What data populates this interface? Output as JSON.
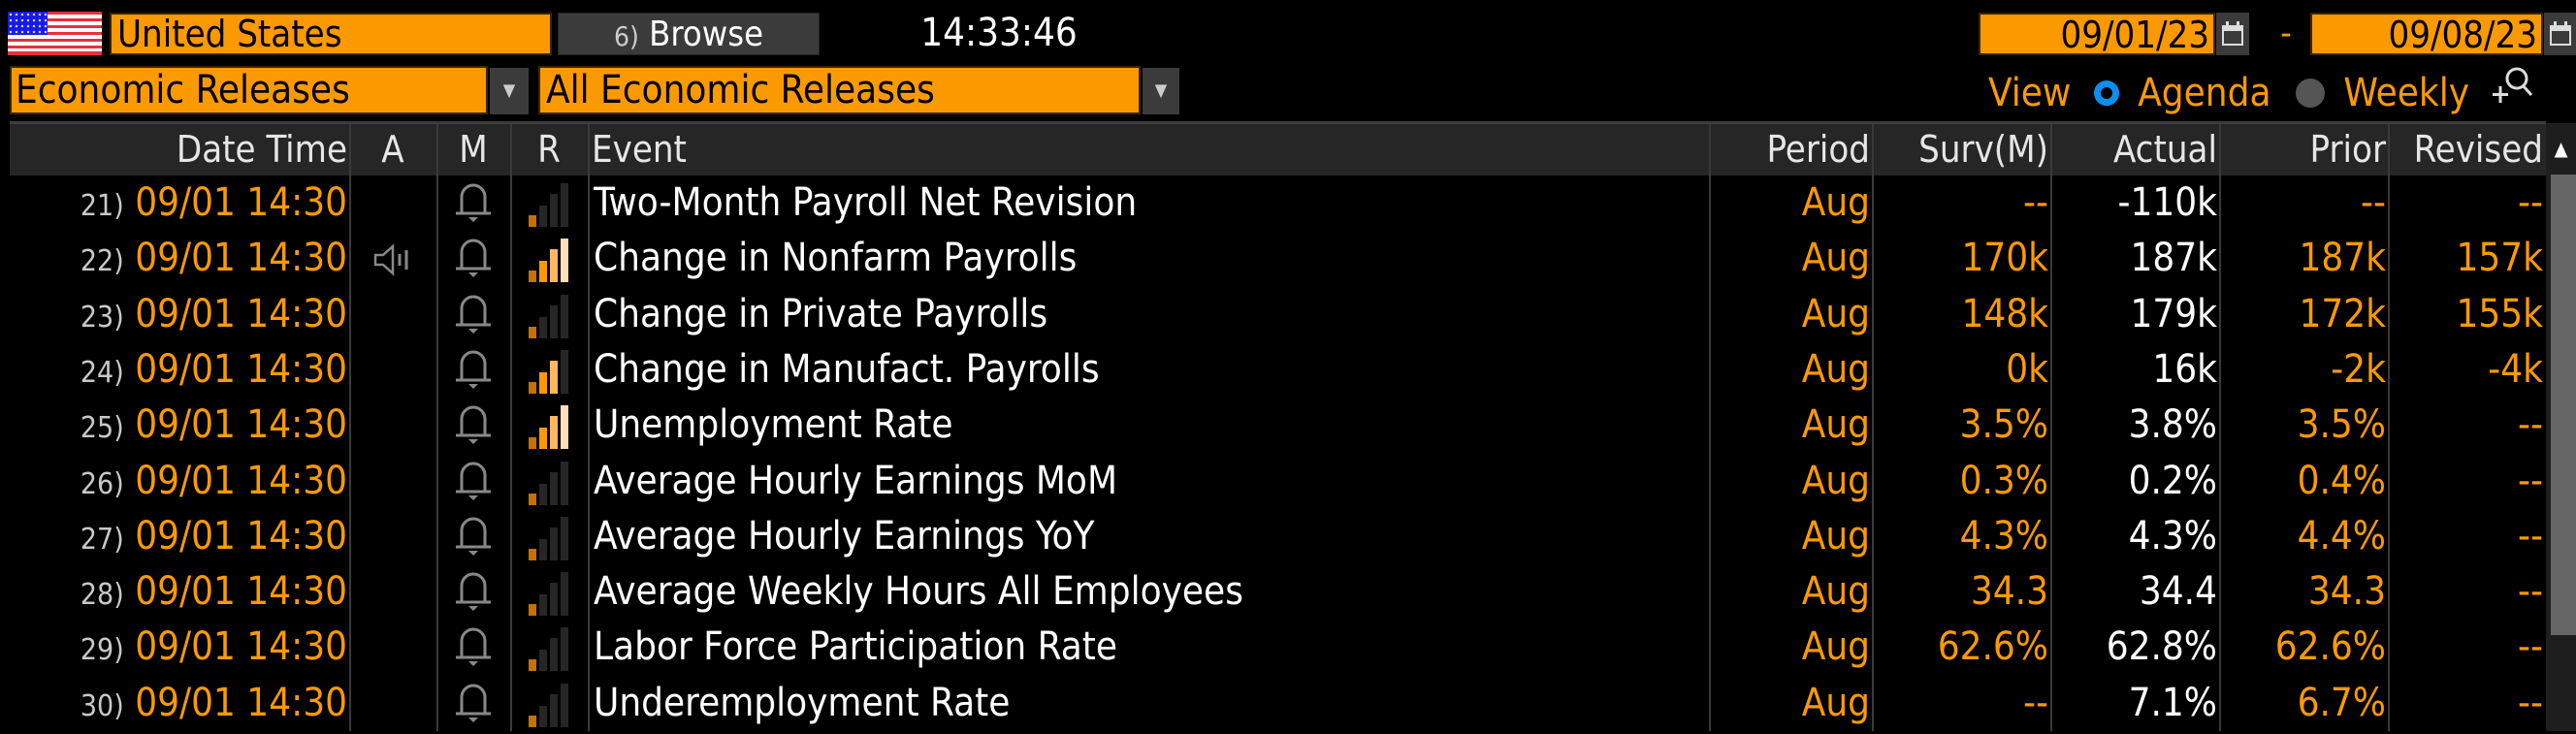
{
  "toolbar": {
    "country": "United States",
    "country_flag": "us-flag-icon",
    "browse_number": "6)",
    "browse_label": "Browse",
    "clock": "14:33:46",
    "start_date": "09/01/23",
    "end_date": "09/08/23",
    "date_separator": "-",
    "category_dropdown": "Economic Releases",
    "filter_dropdown": "All Economic Releases",
    "view_label": "View",
    "view_options": [
      {
        "label": "Agenda",
        "selected": true
      },
      {
        "label": "Weekly",
        "selected": false
      }
    ]
  },
  "table": {
    "columns": [
      "Date Time",
      "A",
      "M",
      "R",
      "Event",
      "Period",
      "Surv(M)",
      "Actual",
      "Prior",
      "Revised"
    ],
    "rows": [
      {
        "num": "21)",
        "datetime": "09/01 14:30",
        "audio": false,
        "alert": true,
        "relevance": 1,
        "event": "Two-Month Payroll Net Revision",
        "period": "Aug",
        "survey": "--",
        "actual": "-110k",
        "prior": "--",
        "revised": "--"
      },
      {
        "num": "22)",
        "datetime": "09/01 14:30",
        "audio": true,
        "alert": true,
        "relevance": 4,
        "event": "Change in Nonfarm Payrolls",
        "period": "Aug",
        "survey": "170k",
        "actual": "187k",
        "prior": "187k",
        "revised": "157k"
      },
      {
        "num": "23)",
        "datetime": "09/01 14:30",
        "audio": false,
        "alert": true,
        "relevance": 1,
        "event": "Change in Private Payrolls",
        "period": "Aug",
        "survey": "148k",
        "actual": "179k",
        "prior": "172k",
        "revised": "155k"
      },
      {
        "num": "24)",
        "datetime": "09/01 14:30",
        "audio": false,
        "alert": true,
        "relevance": 3,
        "event": "Change in Manufact. Payrolls",
        "period": "Aug",
        "survey": "0k",
        "actual": "16k",
        "prior": "-2k",
        "revised": "-4k"
      },
      {
        "num": "25)",
        "datetime": "09/01 14:30",
        "audio": false,
        "alert": true,
        "relevance": 4,
        "event": "Unemployment Rate",
        "period": "Aug",
        "survey": "3.5%",
        "actual": "3.8%",
        "prior": "3.5%",
        "revised": "--"
      },
      {
        "num": "26)",
        "datetime": "09/01 14:30",
        "audio": false,
        "alert": true,
        "relevance": 1,
        "event": "Average Hourly Earnings MoM",
        "period": "Aug",
        "survey": "0.3%",
        "actual": "0.2%",
        "prior": "0.4%",
        "revised": "--"
      },
      {
        "num": "27)",
        "datetime": "09/01 14:30",
        "audio": false,
        "alert": true,
        "relevance": 1,
        "event": "Average Hourly Earnings YoY",
        "period": "Aug",
        "survey": "4.3%",
        "actual": "4.3%",
        "prior": "4.4%",
        "revised": "--"
      },
      {
        "num": "28)",
        "datetime": "09/01 14:30",
        "audio": false,
        "alert": true,
        "relevance": 1,
        "event": "Average Weekly Hours All Employees",
        "period": "Aug",
        "survey": "34.3",
        "actual": "34.4",
        "prior": "34.3",
        "revised": "--"
      },
      {
        "num": "29)",
        "datetime": "09/01 14:30",
        "audio": false,
        "alert": true,
        "relevance": 1,
        "event": "Labor Force Participation Rate",
        "period": "Aug",
        "survey": "62.6%",
        "actual": "62.8%",
        "prior": "62.6%",
        "revised": "--"
      },
      {
        "num": "30)",
        "datetime": "09/01 14:30",
        "audio": false,
        "alert": true,
        "relevance": 1,
        "event": "Underemployment Rate",
        "period": "Aug",
        "survey": "--",
        "actual": "7.1%",
        "prior": "6.7%",
        "revised": "--"
      }
    ]
  },
  "colors": {
    "accent": "#fb9a00",
    "background": "#000000",
    "header_bg": "#262626",
    "actual_text": "#ffffff",
    "radio_selected": "#0a8ff0",
    "relevance_bar_colors": [
      "#c87000",
      "#fb9a00",
      "#ffb860",
      "#ffe0b8"
    ],
    "relevance_bar_off": "#262626"
  }
}
